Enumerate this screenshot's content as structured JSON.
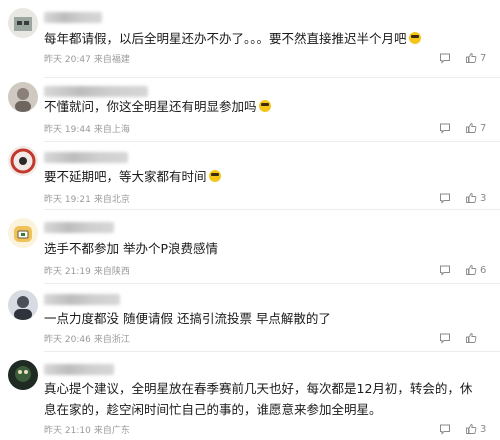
{
  "comments": [
    {
      "text": "每年都请假，以后全明星还办不办了。。。要不然直接推迟半个月吧",
      "emoji": "sweat-smile-emoji",
      "time": "昨天 20:47",
      "location": "来自福建",
      "likes": "7",
      "avatar_color": "#9aa7a0"
    },
    {
      "text": "不懂就问，你这全明星还有明显参加吗",
      "emoji": "sunglasses-emoji",
      "time": "昨天 19:44",
      "location": "来自上海",
      "likes": "7",
      "avatar_color": "#8a8079"
    },
    {
      "text": "要不延期吧，等大家都有时间",
      "emoji": "sweat-smile-emoji",
      "time": "昨天 19:21",
      "location": "来自北京",
      "likes": "3",
      "avatar_color": "#c0392b"
    },
    {
      "text": "选手不都参加 举办个P浪费感情",
      "emoji": "",
      "time": "昨天 21:19",
      "location": "来自陕西",
      "likes": "6",
      "avatar_color": "#f0c35a"
    },
    {
      "text": "一点力度都没 随便请假 还搞引流投票 早点解散的了",
      "emoji": "",
      "time": "昨天 20:46",
      "location": "来自浙江",
      "likes": "",
      "avatar_color": "#4a4f5a"
    },
    {
      "text": "真心提个建议，全明星放在春季赛前几天也好，每次都是12月初，转会的，休息在家的，趁空闲时间忙自己的事的，谁愿意来参加全明星。",
      "emoji": "",
      "time": "昨天 21:10",
      "location": "来自广东",
      "likes": "3",
      "avatar_color": "#3b5d3a"
    }
  ]
}
